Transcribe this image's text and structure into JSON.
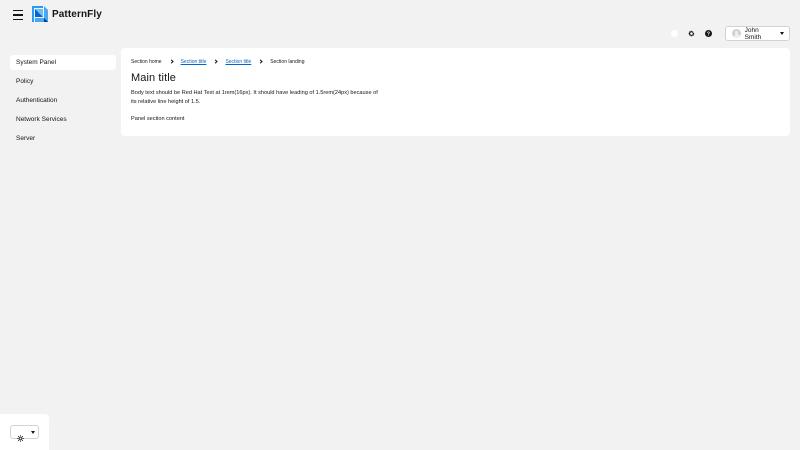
{
  "brand": {
    "name": "PatternFly",
    "logo_colors": [
      "#2b9af3",
      "#0066cc",
      "#73bcf7"
    ]
  },
  "masthead": {
    "menu_icon": "hamburger-icon",
    "tools": [
      {
        "icon": "bell-icon"
      },
      {
        "icon": "gear-icon"
      },
      {
        "icon": "question-circle-icon"
      }
    ],
    "user": {
      "name": "John Smith",
      "avatar_icon": "avatar-icon"
    }
  },
  "sidebar": {
    "items": [
      {
        "label": "System Panel",
        "active": true
      },
      {
        "label": "Policy",
        "active": false
      },
      {
        "label": "Authentication",
        "active": false
      },
      {
        "label": "Network Services",
        "active": false
      },
      {
        "label": "Server",
        "active": false
      }
    ]
  },
  "theme_toggle": {
    "icon": "sun-icon"
  },
  "breadcrumb": [
    {
      "label": "Section home",
      "link": false
    },
    {
      "label": "Section title",
      "link": true
    },
    {
      "label": "Section title",
      "link": true
    },
    {
      "label": "Section landing",
      "link": false
    }
  ],
  "main": {
    "title": "Main title",
    "body": "Body text should be Red Hat Text at 1rem(16px). It should have leading of 1.5rem(24px) because of its relative line height of 1.5.",
    "panel_content": "Panel section content"
  },
  "colors": {
    "background": "#f2f2f2",
    "surface": "#ffffff",
    "link": "#0066cc",
    "text": "#151515",
    "border": "#d2d2d2"
  }
}
